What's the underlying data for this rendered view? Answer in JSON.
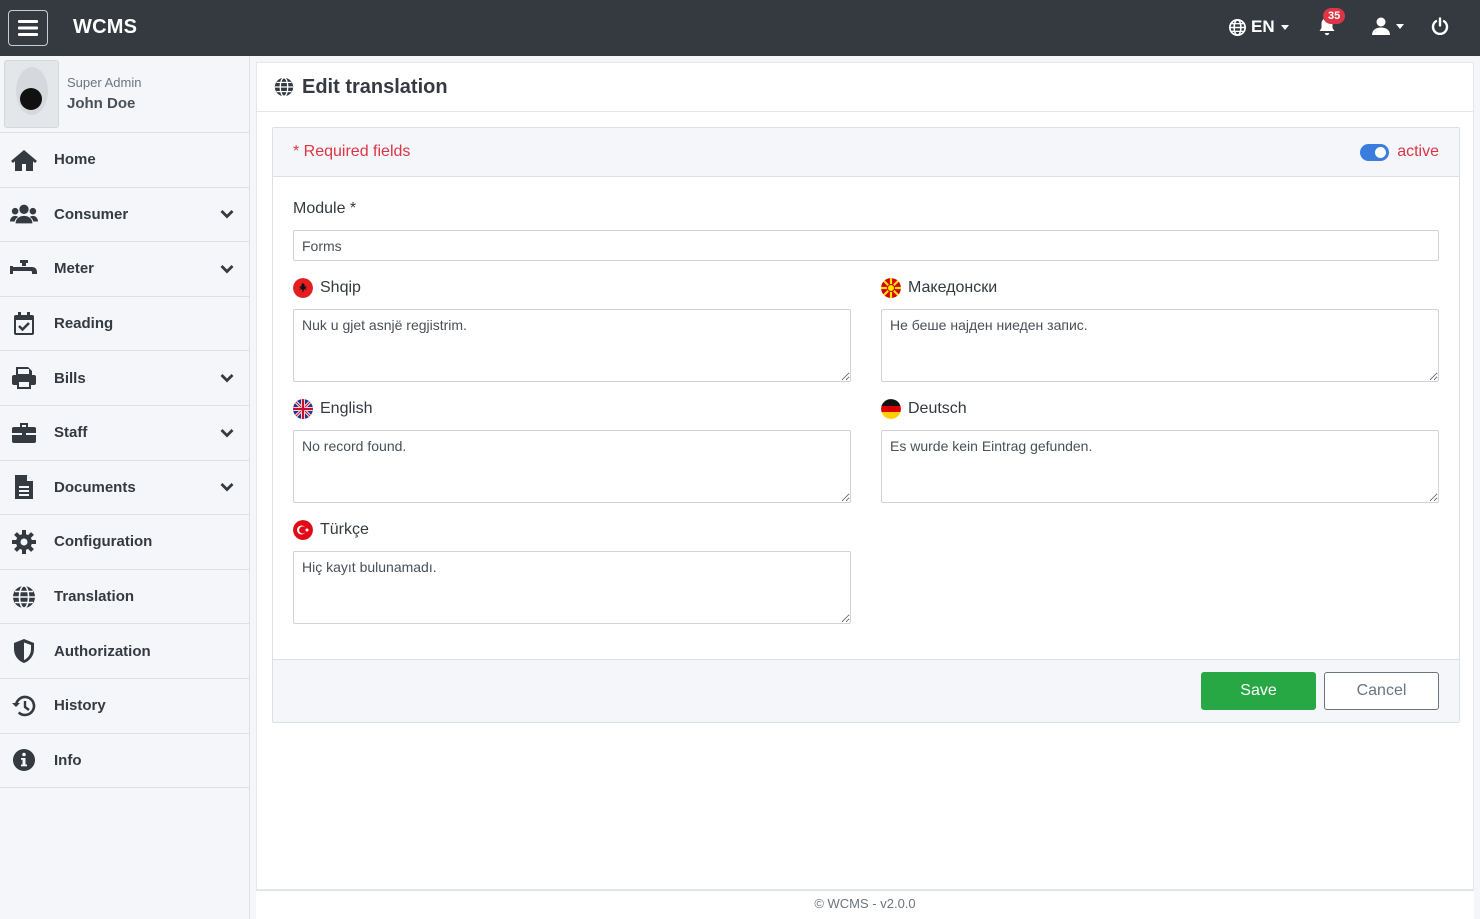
{
  "navbar": {
    "brand": "WCMS",
    "language": "EN",
    "notifications_count": "35"
  },
  "user": {
    "role": "Super Admin",
    "name": "John Doe"
  },
  "sidebar": {
    "items": [
      {
        "label": "Home",
        "icon": "home-icon",
        "expandable": false
      },
      {
        "label": "Consumer",
        "icon": "users-icon",
        "expandable": true
      },
      {
        "label": "Meter",
        "icon": "faucet-icon",
        "expandable": true
      },
      {
        "label": "Reading",
        "icon": "calendar-check-icon",
        "expandable": false
      },
      {
        "label": "Bills",
        "icon": "printer-icon",
        "expandable": true
      },
      {
        "label": "Staff",
        "icon": "briefcase-icon",
        "expandable": true
      },
      {
        "label": "Documents",
        "icon": "document-icon",
        "expandable": true
      },
      {
        "label": "Configuration",
        "icon": "gear-icon",
        "expandable": false
      },
      {
        "label": "Translation",
        "icon": "globe-icon",
        "expandable": false
      },
      {
        "label": "Authorization",
        "icon": "shield-icon",
        "expandable": false
      },
      {
        "label": "History",
        "icon": "history-icon",
        "expandable": false
      },
      {
        "label": "Info",
        "icon": "info-icon",
        "expandable": false
      }
    ]
  },
  "page": {
    "title": "Edit translation"
  },
  "form": {
    "required_note": "* Required fields",
    "status_label": "active",
    "status_on": true,
    "module_label": "Module *",
    "module_value": "Forms",
    "translations": {
      "sq": {
        "label": "Shqip",
        "value": "Nuk u gjet asnjë regjistrim."
      },
      "mk": {
        "label": "Македонски",
        "value": "Не беше најден ниеден запис."
      },
      "en": {
        "label": "English",
        "value": "No record found."
      },
      "de": {
        "label": "Deutsch",
        "value": "Es wurde kein Eintrag gefunden."
      },
      "tr": {
        "label": "Türkçe",
        "value": "Hiç kayıt bulunamadı."
      }
    },
    "save_label": "Save",
    "cancel_label": "Cancel"
  },
  "footer": {
    "text": "© WCMS - v2.0.0"
  },
  "colors": {
    "navbar": "#343a40",
    "required": "#dc3545",
    "toggle": "#3b7ddd",
    "save": "#28a745"
  }
}
